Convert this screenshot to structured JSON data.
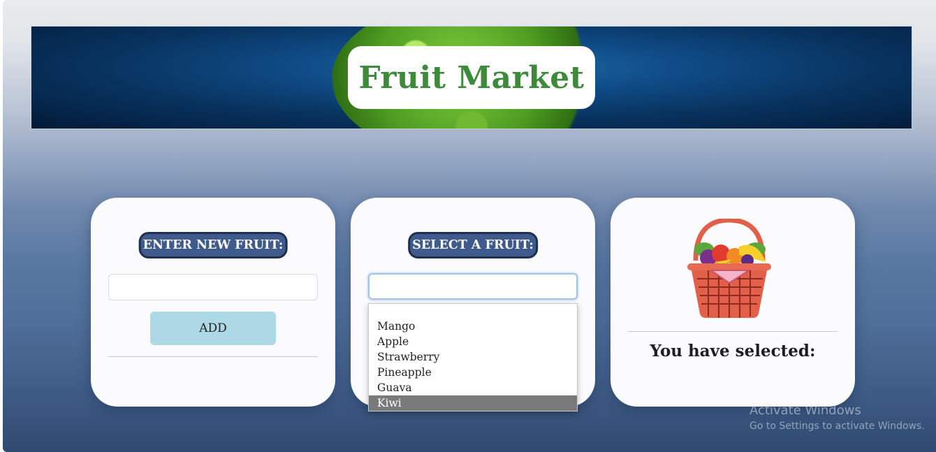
{
  "header": {
    "title": "Fruit Market"
  },
  "add_card": {
    "heading": "ENTER NEW FRUIT:",
    "input_value": "",
    "add_label": "ADD"
  },
  "select_card": {
    "heading": "SELECT A FRUIT:",
    "input_value": "",
    "options": [
      "Mango",
      "Apple",
      "Strawberry",
      "Pineapple",
      "Guava",
      "Kiwi"
    ],
    "highlighted": "Kiwi"
  },
  "result_card": {
    "image": "fruit-basket-icon",
    "label": "You have selected:"
  },
  "watermark": {
    "title": "Activate Windows",
    "subtitle": "Go to Settings to activate Windows."
  },
  "colors": {
    "pill_bg": "#3f5a8c",
    "add_button": "#add8e6",
    "title_green": "#3c8a3a",
    "highlight": "#7a7a7a"
  }
}
